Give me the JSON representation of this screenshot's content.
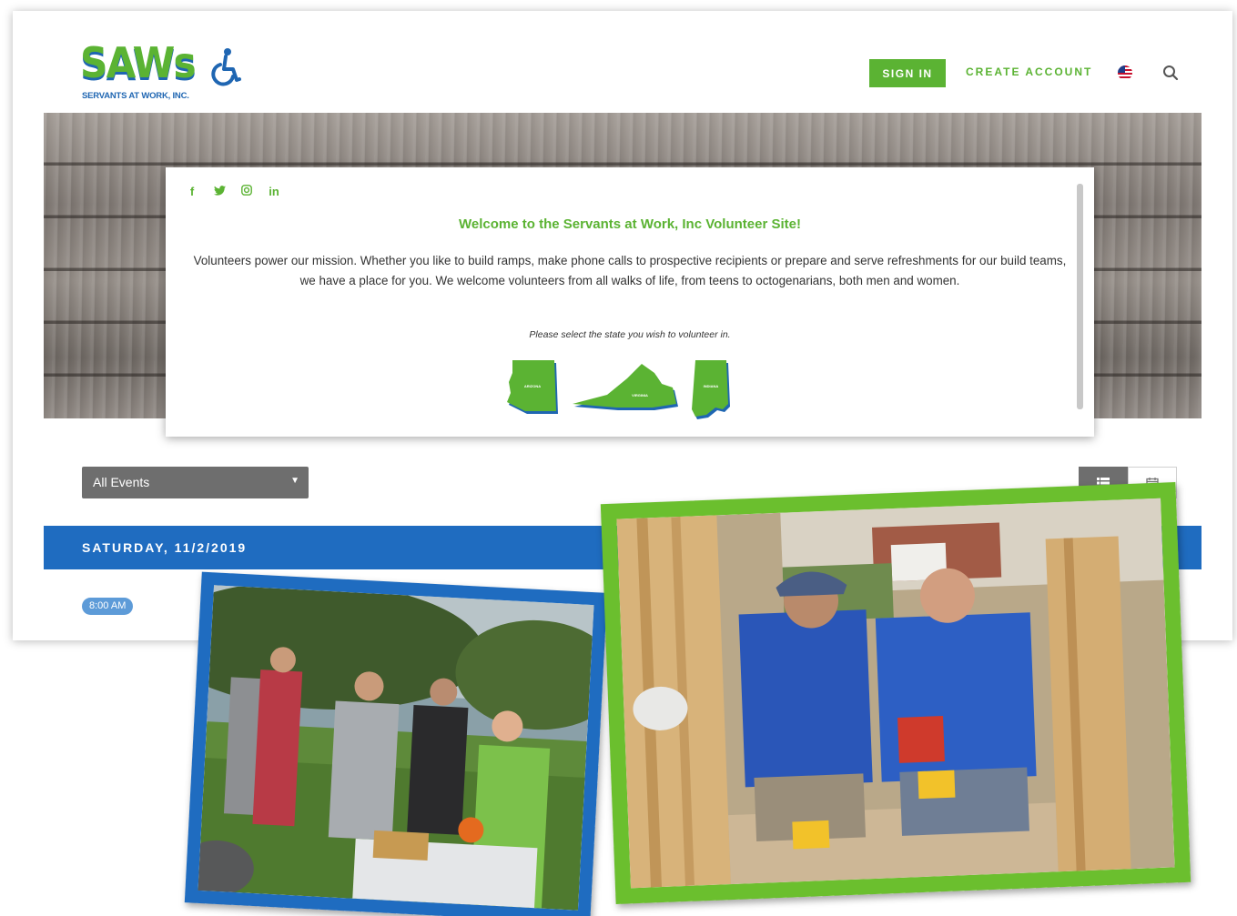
{
  "logo": {
    "wordmark": "SAWs",
    "subtitle": "SERVANTS AT WORK, INC.",
    "icon": "wheelchair-icon"
  },
  "nav": {
    "sign_in": "SIGN IN",
    "create_account": "CREATE ACCOUNT",
    "flag_icon": "us-flag-icon",
    "search_icon": "search-icon"
  },
  "social": [
    "f",
    "t",
    "ig",
    "in"
  ],
  "welcome": {
    "title": "Welcome to the Servants at Work, Inc Volunteer Site!",
    "body": "Volunteers power our mission. Whether you like to build ramps, make phone calls to prospective recipients or prepare and serve refreshments for our build teams, we have a place for you. We welcome volunteers from all walks of life, from teens to octogenarians, both men and women.",
    "prompt": "Please select the state you wish to volunteer in.",
    "states": [
      "ARIZONA",
      "VIRGINIA",
      "INDIANA"
    ]
  },
  "filter": {
    "selected": "All Events"
  },
  "date_bar": {
    "date": "SATURDAY, 11/2/2019"
  },
  "event": {
    "time": "8:00 AM"
  },
  "colors": {
    "green": "#5bb333",
    "blue": "#1f6cc0"
  }
}
